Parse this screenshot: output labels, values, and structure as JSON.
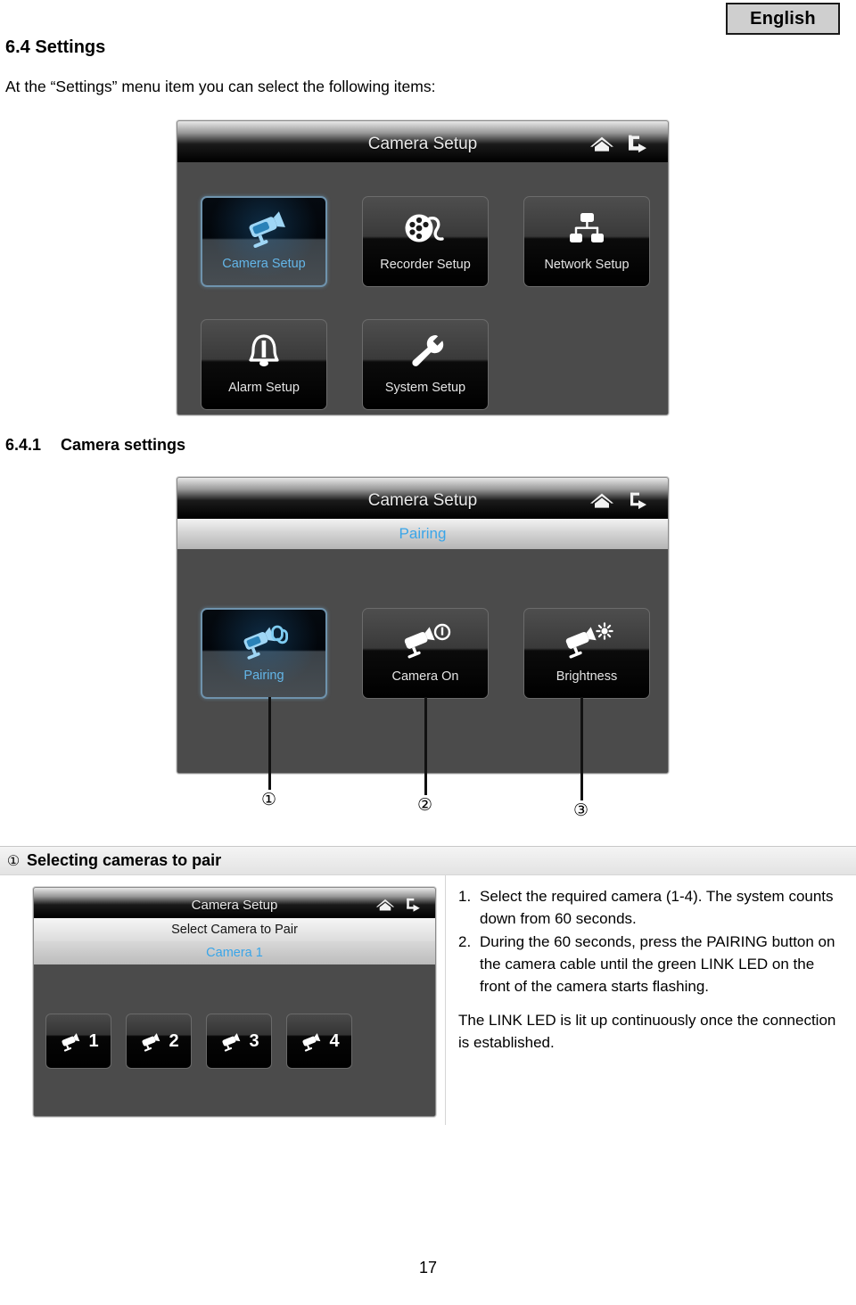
{
  "language_badge": {
    "label": "English"
  },
  "document": {
    "section_number": "6.4",
    "section_title": "Settings",
    "heading": "6.4 Settings",
    "intro": "At the “Settings” menu item you can select the following items:",
    "subsection_number": "6.4.1",
    "subsection_title": "Camera settings",
    "page_number": "17"
  },
  "screen1": {
    "title": "Camera Setup",
    "icons": {
      "home": "home-icon",
      "return": "return-icon"
    },
    "tiles": [
      {
        "label": "Camera Setup",
        "icon": "security-camera-icon",
        "selected": true
      },
      {
        "label": "Recorder Setup",
        "icon": "film-reel-icon",
        "selected": false
      },
      {
        "label": "Network Setup",
        "icon": "network-tree-icon",
        "selected": false
      },
      {
        "label": "Alarm Setup",
        "icon": "bell-icon",
        "selected": false
      },
      {
        "label": "System Setup",
        "icon": "wrench-icon",
        "selected": false
      }
    ]
  },
  "screen2": {
    "title": "Camera Setup",
    "subtitle": "Pairing",
    "icons": {
      "home": "home-icon",
      "return": "return-icon"
    },
    "tiles": [
      {
        "label": "Pairing",
        "icon": "camera-link-icon",
        "selected": true
      },
      {
        "label": "Camera On",
        "icon": "camera-power-icon",
        "selected": false
      },
      {
        "label": "Brightness",
        "icon": "camera-brightness-icon",
        "selected": false
      }
    ],
    "callouts": [
      "①",
      "②",
      "③"
    ]
  },
  "info_box": {
    "callout_number": "①",
    "title": "Selecting cameras to pair",
    "screen": {
      "title": "Camera Setup",
      "subtitle": "Select Camera to Pair",
      "selected_camera": "Camera 1",
      "icons": {
        "home": "home-icon",
        "return": "return-icon"
      },
      "camera_buttons": [
        "1",
        "2",
        "3",
        "4"
      ]
    },
    "steps": [
      {
        "marker": "1.",
        "text": "Select the required camera (1-4). The system counts down from 60 seconds."
      },
      {
        "marker": "2.",
        "text": "During the 60 seconds, press the PAIRING button on the camera cable until the green LINK LED on the front of the camera starts flashing."
      }
    ],
    "note": "The LINK LED is lit up continuously once the connection is established."
  },
  "colors": {
    "accent_blue": "#3aa5e8",
    "selected_label_blue": "#64b6e8",
    "screen_bg": "#4b4b4b",
    "badge_bg": "#cfcfcf"
  }
}
